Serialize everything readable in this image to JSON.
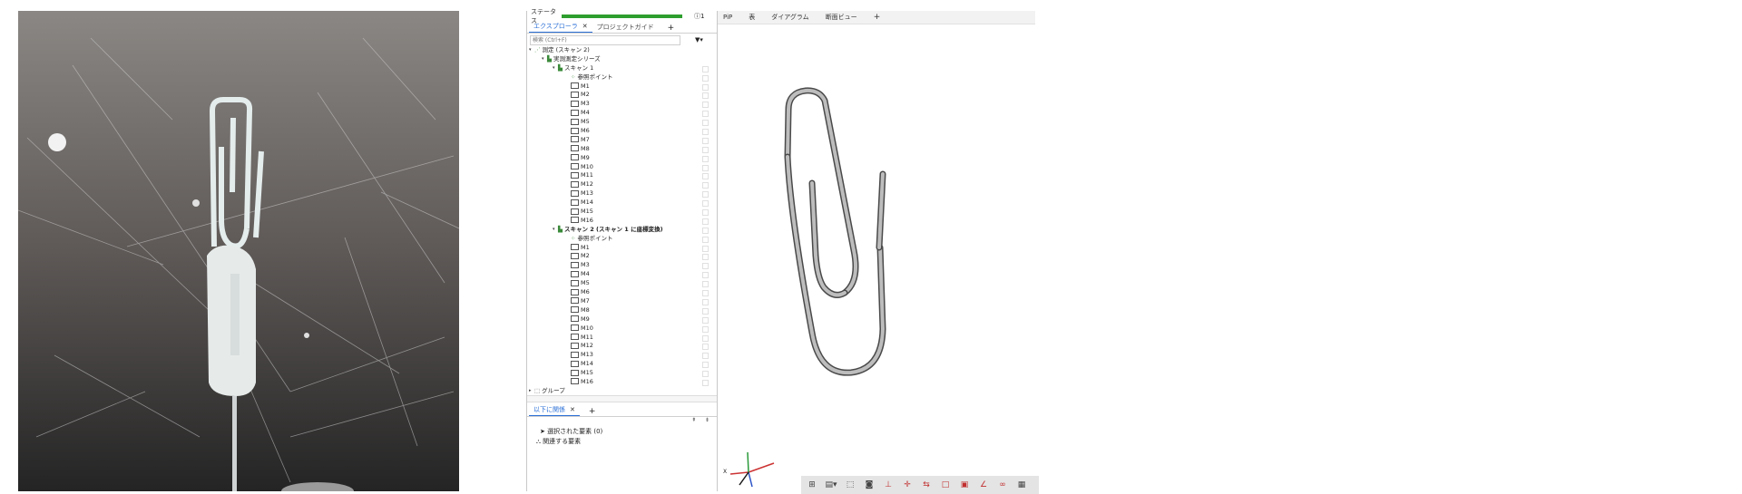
{
  "status": {
    "label": "ステータス",
    "progress": 1.0,
    "info_count": "1"
  },
  "explorer": {
    "tabs": [
      {
        "label": "エクスプローラ"
      },
      {
        "label": "プロジェクトガイド"
      }
    ],
    "search_placeholder": "検索 (Ctrl+F)",
    "tree": {
      "root": "測定 (スキャン 2)",
      "series": "実測測定シリーズ",
      "scan1": "スキャン 1",
      "scan2": "スキャン 2 (スキャン 1 に座標変換)",
      "ref_point": "参照ポイント",
      "measurements": [
        "M1",
        "M2",
        "M3",
        "M4",
        "M5",
        "M6",
        "M7",
        "M8",
        "M9",
        "M10",
        "M11",
        "M12",
        "M13",
        "M14",
        "M15",
        "M16"
      ],
      "group": "グループ"
    }
  },
  "related": {
    "tab_label": "以下に関係",
    "rows": [
      "選択された要素 (0)",
      "関連する要素"
    ]
  },
  "viewport": {
    "tabs": [
      "PiP",
      "表",
      "ダイアグラム",
      "断面ビュー"
    ],
    "axis_label": "X"
  },
  "colors": {
    "accent": "#2a6fd6",
    "progress": "#2e9e2e"
  }
}
